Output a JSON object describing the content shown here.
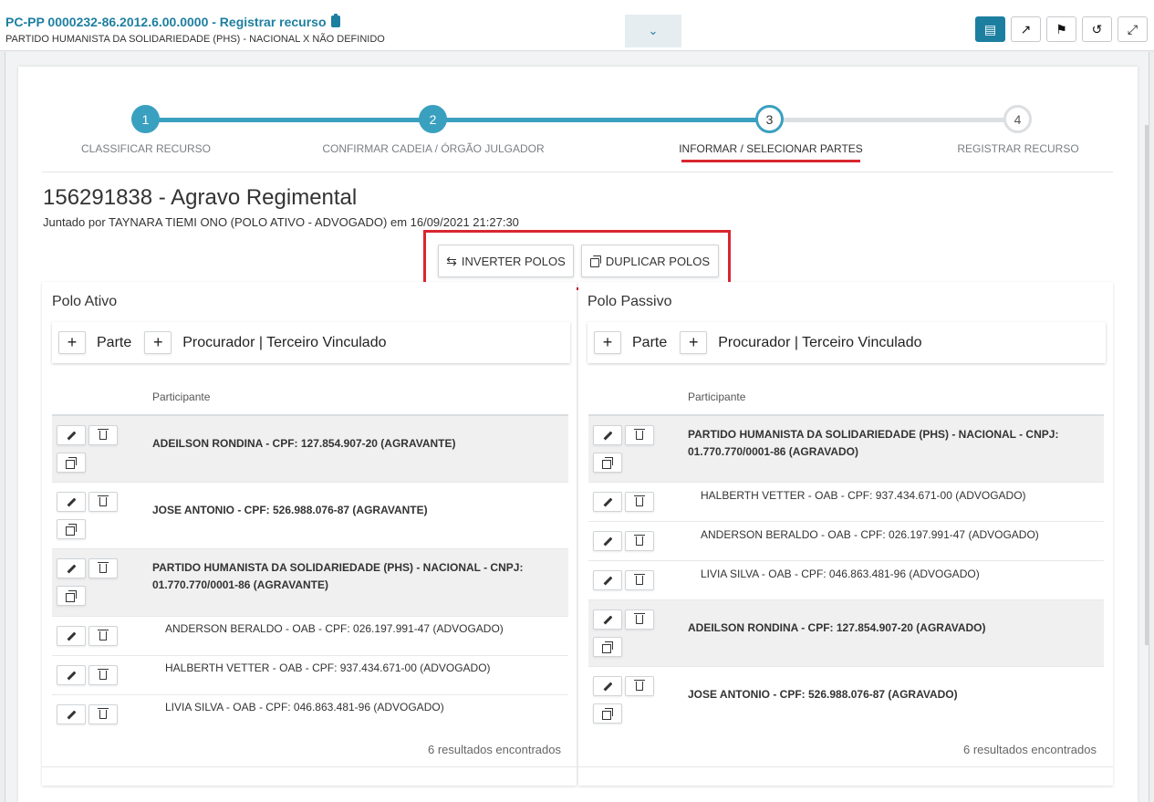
{
  "header": {
    "title": "PC-PP 0000232-86.2012.6.00.0000 - Registrar recurso",
    "subtitle": "PARTIDO HUMANISTA DA SOLIDARIEDADE (PHS) - NACIONAL X NÃO DEFINIDO",
    "dropdown_icon": "chevron-down-icon",
    "buttons": [
      {
        "icon": "document-icon",
        "active": true
      },
      {
        "icon": "share-icon",
        "active": false
      },
      {
        "icon": "tag-icon",
        "active": false
      },
      {
        "icon": "history-icon",
        "active": false
      },
      {
        "icon": "fullscreen-icon",
        "active": false
      }
    ]
  },
  "stepper": {
    "steps": [
      {
        "number": "1",
        "label": "CLASSIFICAR RECURSO",
        "state": "done"
      },
      {
        "number": "2",
        "label": "CONFIRMAR CADEIA / ÓRGÃO JULGADOR",
        "state": "done"
      },
      {
        "number": "3",
        "label": "INFORMAR / SELECIONAR PARTES",
        "state": "current"
      },
      {
        "number": "4",
        "label": "REGISTRAR RECURSO",
        "state": "todo"
      }
    ]
  },
  "document": {
    "title": "156291838 - Agravo Regimental",
    "subtitle": "Juntado por TAYNARA TIEMI ONO (POLO ATIVO - ADVOGADO) em 16/09/2021 21:27:30"
  },
  "actions": {
    "invert_label": "INVERTER POLOS",
    "duplicate_label": "DUPLICAR POLOS"
  },
  "toolbar": {
    "plus": "+",
    "parte": "Parte",
    "procurador": "Procurador | Terceiro Vinculado"
  },
  "column_header": "Participante",
  "polo_ativo": {
    "title": "Polo Ativo",
    "rows": [
      {
        "text": "ADEILSON RONDINA - CPF: 127.854.907-20 (AGRAVANTE)",
        "bold": true
      },
      {
        "text": "JOSE ANTONIO - CPF: 526.988.076-87 (AGRAVANTE)",
        "bold": true
      },
      {
        "text": "PARTIDO HUMANISTA DA SOLIDARIEDADE (PHS) - NACIONAL - CNPJ: 01.770.770/0001-86 (AGRAVANTE)",
        "bold": true
      },
      {
        "text": "ANDERSON BERALDO - OAB - CPF: 026.197.991-47 (ADVOGADO)",
        "bold": false
      },
      {
        "text": "HALBERTH VETTER - OAB - CPF: 937.434.671-00 (ADVOGADO)",
        "bold": false
      },
      {
        "text": "LIVIA SILVA - OAB - CPF: 046.863.481-96 (ADVOGADO)",
        "bold": false
      }
    ],
    "results": "6 resultados encontrados"
  },
  "polo_passivo": {
    "title": "Polo Passivo",
    "rows": [
      {
        "text": "PARTIDO HUMANISTA DA SOLIDARIEDADE (PHS) - NACIONAL - CNPJ: 01.770.770/0001-86 (AGRAVADO)",
        "bold": true
      },
      {
        "text": "HALBERTH VETTER - OAB - CPF: 937.434.671-00 (ADVOGADO)",
        "bold": false
      },
      {
        "text": "ANDERSON BERALDO - OAB - CPF: 026.197.991-47 (ADVOGADO)",
        "bold": false
      },
      {
        "text": "LIVIA SILVA - OAB - CPF: 046.863.481-96 (ADVOGADO)",
        "bold": false
      },
      {
        "text": "ADEILSON RONDINA - CPF: 127.854.907-20 (AGRAVADO)",
        "bold": true
      },
      {
        "text": "JOSE ANTONIO - CPF: 526.988.076-87 (AGRAVADO)",
        "bold": true
      }
    ],
    "results": "6 resultados encontrados"
  },
  "colors": {
    "primary": "#1d7fa0",
    "step_active": "#3aa0c0",
    "highlight": "#d9262f"
  }
}
